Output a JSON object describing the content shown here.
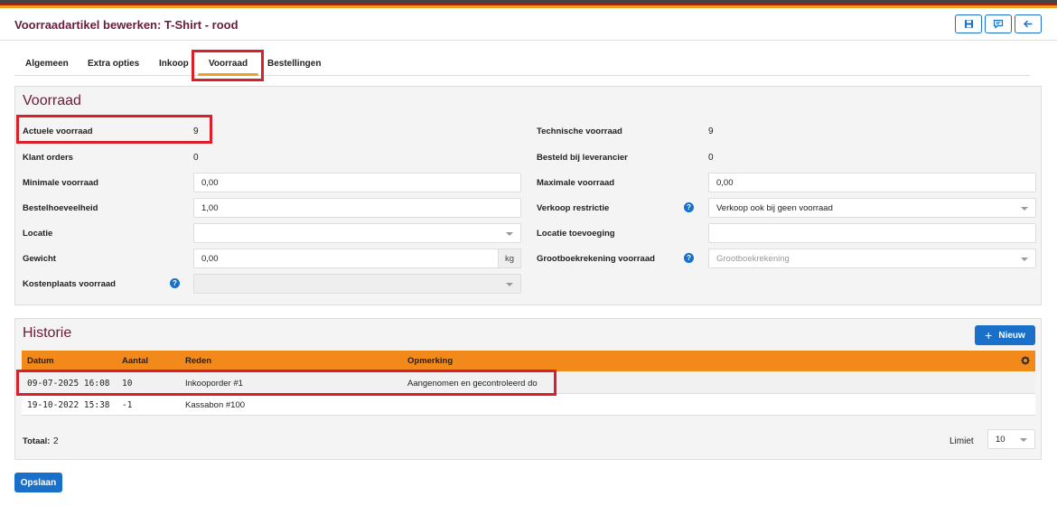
{
  "header": {
    "title": "Voorraadartikel bewerken: T-Shirt - rood",
    "buttons": [
      {
        "icon": "save-icon",
        "glyph": "💾"
      },
      {
        "icon": "comment-icon",
        "glyph": "▭"
      },
      {
        "icon": "arrow-left-icon",
        "glyph": "←"
      }
    ]
  },
  "tabs": [
    "Algemeen",
    "Extra opties",
    "Inkoop",
    "Voorraad",
    "Bestellingen"
  ],
  "active_tab": "Voorraad",
  "voorraad": {
    "title": "Voorraad",
    "actuele_voorraad_label": "Actuele voorraad",
    "actuele_voorraad_value": "9",
    "klant_orders_label": "Klant orders",
    "klant_orders_value": "0",
    "minimale_voorraad_label": "Minimale voorraad",
    "minimale_voorraad_value": "0,00",
    "bestelhoeveelheid_label": "Bestelhoeveelheid",
    "bestelhoeveelheid_value": "1,00",
    "locatie_label": "Locatie",
    "locatie_value": "",
    "gewicht_label": "Gewicht",
    "gewicht_value": "0,00",
    "gewicht_unit": "kg",
    "kostenplaats_label": "Kostenplaats voorraad",
    "kostenplaats_value": "",
    "technische_voorraad_label": "Technische voorraad",
    "technische_voorraad_value": "9",
    "besteld_label": "Besteld bij leverancier",
    "besteld_value": "0",
    "maximale_voorraad_label": "Maximale voorraad",
    "maximale_voorraad_value": "0,00",
    "verkoop_restrictie_label": "Verkoop restrictie",
    "verkoop_restrictie_value": "Verkoop ook bij geen voorraad",
    "locatie_toevoeging_label": "Locatie toevoeging",
    "locatie_toevoeging_value": "",
    "grootboek_label": "Grootboekrekening voorraad",
    "grootboek_placeholder": "Grootboekrekening",
    "help_glyph": "?"
  },
  "historie": {
    "title": "Historie",
    "new_button": "Nieuw",
    "new_icon": "+",
    "columns": [
      "Datum",
      "Aantal",
      "Reden",
      "Opmerking"
    ],
    "rows": [
      {
        "datum": "09-07-2025 16:08",
        "aantal": "10",
        "reden": "Inkooporder #1",
        "opmerking": "Aangenomen en gecontroleerd do"
      },
      {
        "datum": "19-10-2022 15:38",
        "aantal": "-1",
        "reden": "Kassabon #100",
        "opmerking": ""
      }
    ],
    "totaal_label": "Totaal:",
    "totaal_value": "2",
    "limiet_label": "Limiet",
    "limiet_value": "10"
  },
  "save_button": "Opslaan",
  "colors": {
    "accent": "#f18a1b",
    "brand": "#6b1a3a",
    "primary": "#1a6fc9",
    "highlight": "#d9202a"
  }
}
